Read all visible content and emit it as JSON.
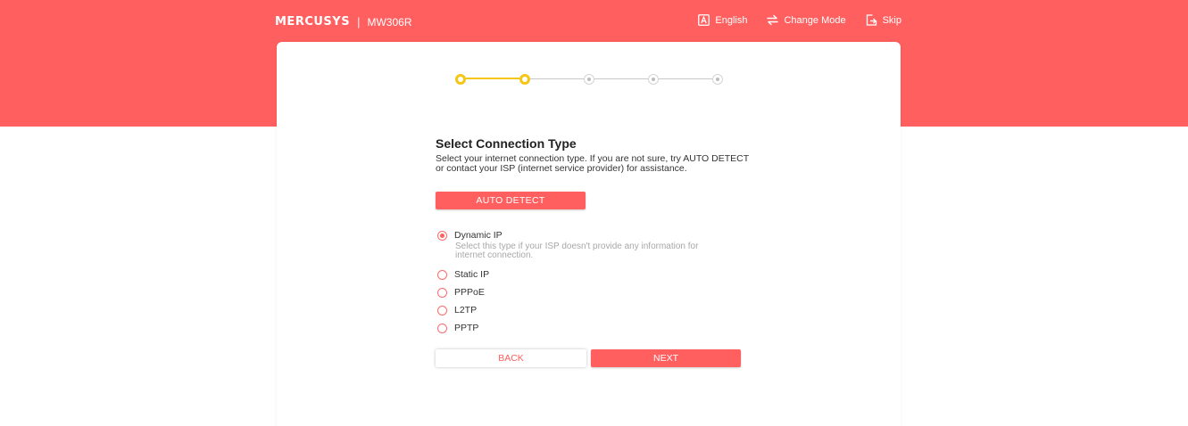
{
  "header": {
    "brand": "MERCUSYS",
    "separator": "|",
    "model": "MW306R",
    "actions": {
      "language": "English",
      "change_mode": "Change Mode",
      "skip": "Skip"
    }
  },
  "stepper": {
    "total_steps": 5,
    "active_steps": 2
  },
  "content": {
    "title": "Select Connection Type",
    "description": "Select your internet connection type. If you are not sure, try AUTO DETECT or contact your ISP (internet service provider) for assistance.",
    "auto_detect_label": "AUTO DETECT"
  },
  "options": {
    "dynamic": {
      "label": "Dynamic IP",
      "hint": "Select this type if your ISP doesn't provide any information for internet connection.",
      "selected": true
    },
    "static": {
      "label": "Static IP",
      "selected": false
    },
    "pppoe": {
      "label": "PPPoE",
      "selected": false
    },
    "l2tp": {
      "label": "L2TP",
      "selected": false
    },
    "pptp": {
      "label": "PPTP",
      "selected": false
    }
  },
  "footer": {
    "back_label": "BACK",
    "next_label": "NEXT"
  },
  "colors": {
    "brand": "#ff5f5f",
    "step_active": "#f5c518",
    "step_inactive": "#c8c8c8"
  },
  "icons": {
    "language": "language-icon",
    "change_mode": "swap-icon",
    "skip": "skip-icon"
  }
}
